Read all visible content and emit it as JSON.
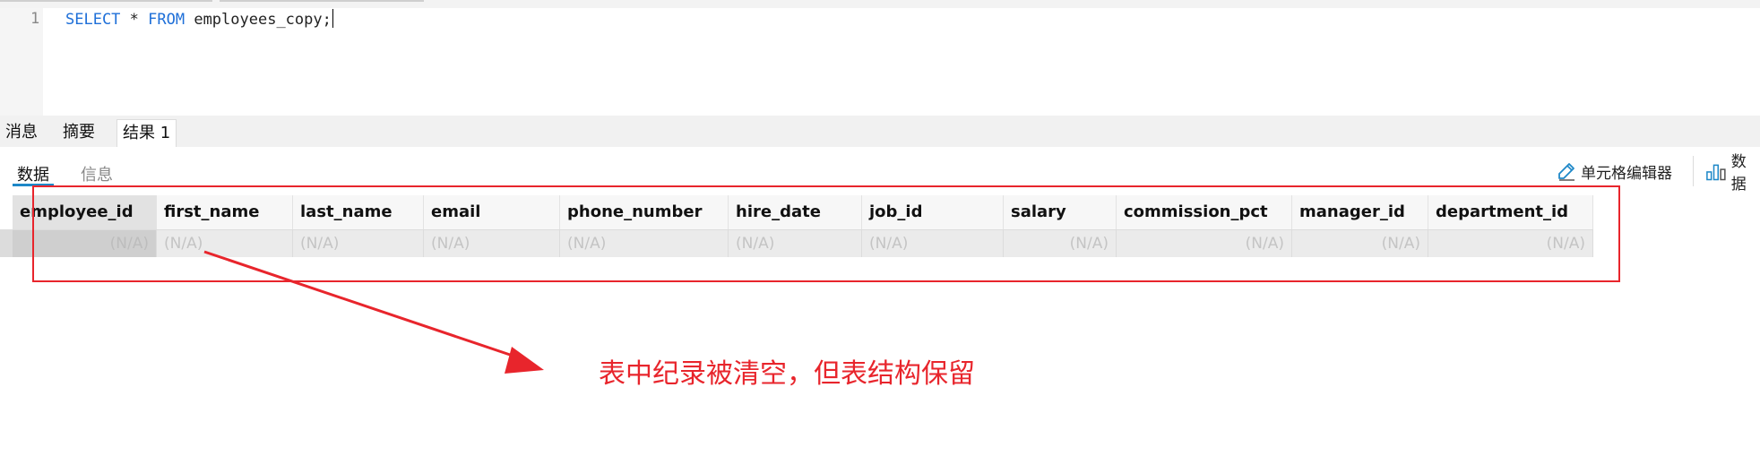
{
  "editor": {
    "line_number": "1",
    "code": {
      "kw1": "SELECT",
      "star": " * ",
      "kw2": "FROM",
      "rest": " employees_copy;"
    }
  },
  "result_tabs": [
    {
      "label": "消息",
      "active": false
    },
    {
      "label": "摘要",
      "active": false
    },
    {
      "label": "结果 1",
      "active": true
    }
  ],
  "subtabs": [
    {
      "label": "数据",
      "active": true
    },
    {
      "label": "信息",
      "active": false
    }
  ],
  "toolbar": {
    "cell_editor_label": "单元格编辑器",
    "data_label": "数据"
  },
  "table": {
    "columns": [
      "employee_id",
      "first_name",
      "last_name",
      "email",
      "phone_number",
      "hire_date",
      "job_id",
      "salary",
      "commission_pct",
      "manager_id",
      "department_id"
    ],
    "rows": [
      [
        "(N/A)",
        "(N/A)",
        "(N/A)",
        "(N/A)",
        "(N/A)",
        "(N/A)",
        "(N/A)",
        "(N/A)",
        "(N/A)",
        "(N/A)",
        "(N/A)"
      ]
    ]
  },
  "annotation": {
    "text": "表中纪录被清空，但表结构保留",
    "color": "#e8252c"
  },
  "colors": {
    "keyword": "#1e6fd8",
    "accent_underline": "#1e88c8",
    "annotation_red": "#e8252c"
  }
}
